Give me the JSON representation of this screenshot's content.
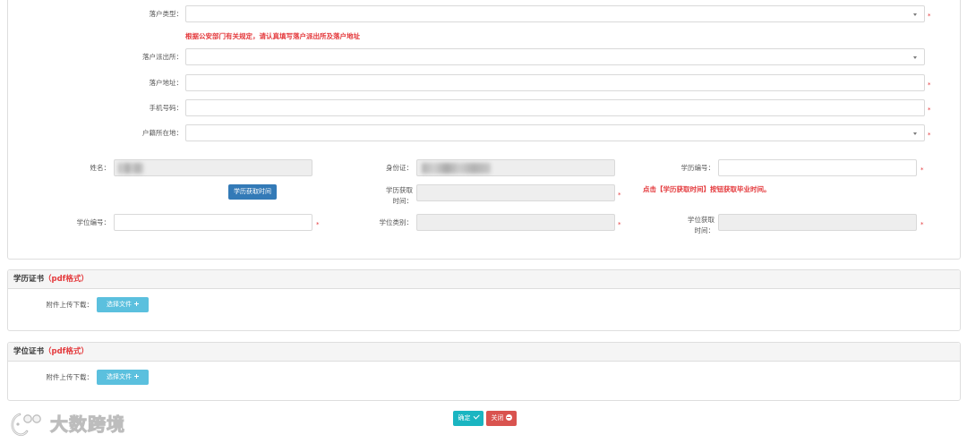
{
  "required_mark": "*",
  "settle": {
    "type_label": "落户类型：",
    "notice": "根据公安部门有关规定，请认真填写落户派出所及落户地址",
    "police_label": "落户派出所：",
    "address_label": "落户地址：",
    "phone_label": "手机号码：",
    "domicile_label": "户籍所在地：",
    "select_icon": "caret-down-icon"
  },
  "education": {
    "name_label": "姓名：",
    "id_label": "身份证：",
    "edu_no_label": "学历编号：",
    "edu_time_button": "学历获取时间",
    "edu_time_label_line1": "学历获取",
    "edu_time_label_line2": "时间：",
    "edu_time_hint": "点击【学历获取时间】按钮获取毕业时间。",
    "degree_no_label": "学位编号：",
    "degree_type_label": "学位类别：",
    "degree_time_label_line1": "学位获取",
    "degree_time_label_line2": "时间："
  },
  "attachments": [
    {
      "title": "学历证书",
      "title_note": "（pdf格式）",
      "upload_label": "附件上传下载：",
      "upload_button": "选择文件",
      "upload_icon": "plus-icon"
    },
    {
      "title": "学位证书",
      "title_note": "（pdf格式）",
      "upload_label": "附件上传下载：",
      "upload_button": "选择文件",
      "upload_icon": "plus-icon"
    }
  ],
  "footer": {
    "confirm_label": "确定",
    "confirm_icon": "check-icon",
    "close_label": "关闭",
    "close_icon": "minus-circle-icon"
  },
  "watermark": {
    "text": "大数跨境",
    "logo_icon": "brand-logo-icon"
  },
  "colors": {
    "required": "#e4393c",
    "primary_button": "#337ab7",
    "info_button": "#5bc0de",
    "confirm_button": "#1ab5c1",
    "close_button": "#d9534f",
    "readonly_field": "#eeeeee",
    "panel_header": "#f5f5f5"
  }
}
